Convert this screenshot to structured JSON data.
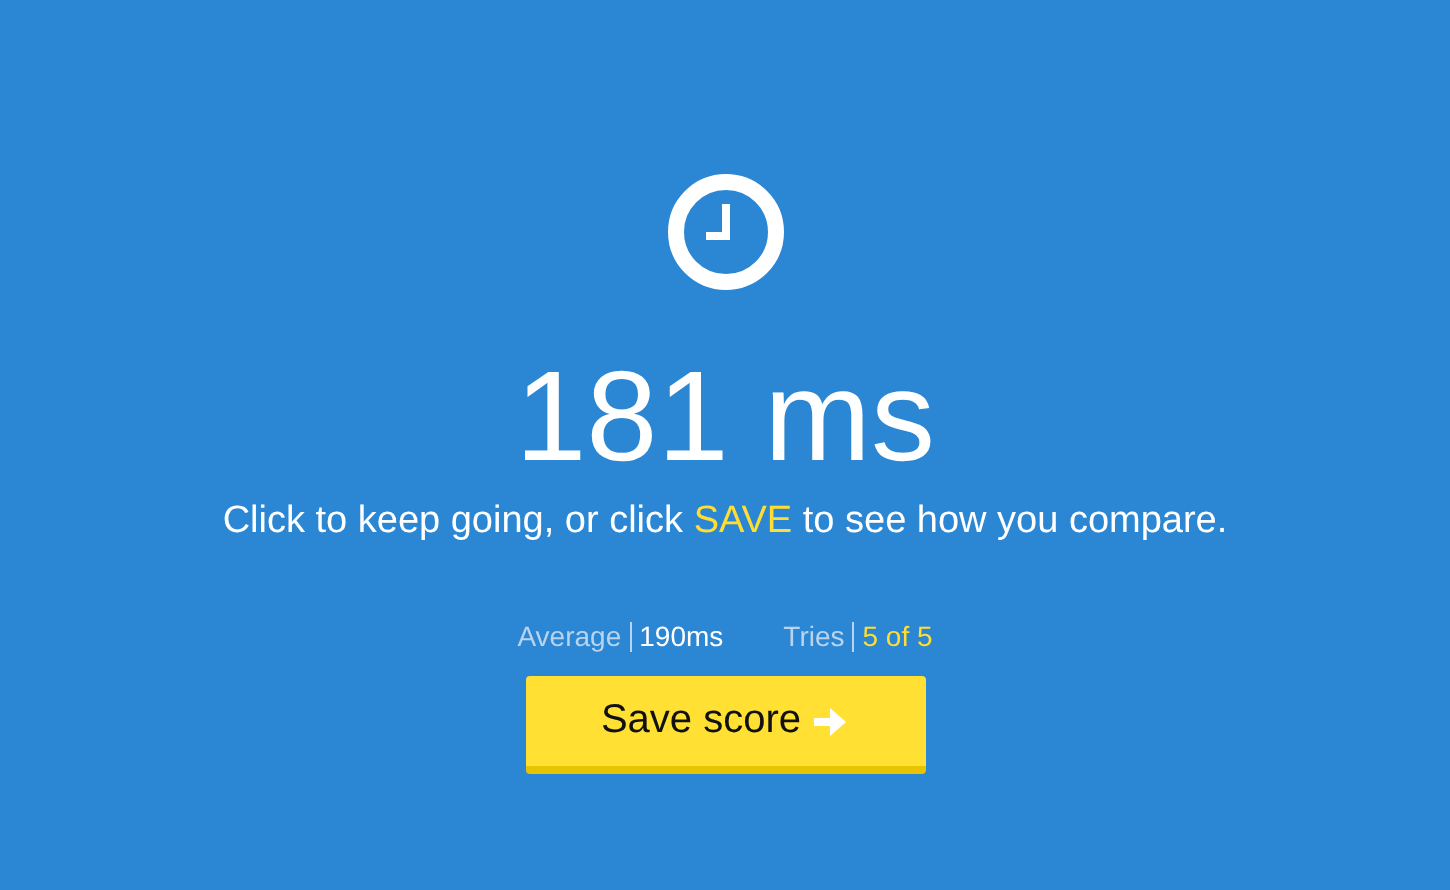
{
  "result": {
    "time": "181 ms"
  },
  "message": {
    "before": "Click to keep going, or click ",
    "highlight": "SAVE",
    "after": " to see how you compare."
  },
  "stats": [
    {
      "label": "Average",
      "value": "190ms",
      "highlighted": false
    },
    {
      "label": "Tries",
      "value": "5 of 5",
      "highlighted": true
    }
  ],
  "button": {
    "label": "Save score"
  }
}
